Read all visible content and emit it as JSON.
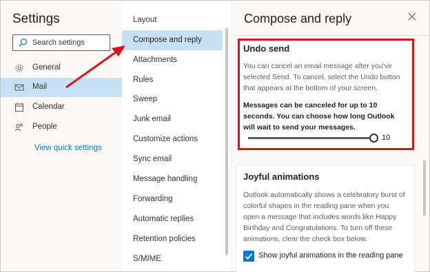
{
  "left": {
    "title": "Settings",
    "search_placeholder": "Search settings",
    "nav": [
      {
        "label": "General",
        "icon": "gear-icon",
        "selected": false
      },
      {
        "label": "Mail",
        "icon": "mail-icon",
        "selected": true
      },
      {
        "label": "Calendar",
        "icon": "calendar-icon",
        "selected": false
      },
      {
        "label": "People",
        "icon": "people-icon",
        "selected": false
      }
    ],
    "quick_settings": "View quick settings"
  },
  "middle": {
    "items": [
      {
        "label": "Layout"
      },
      {
        "label": "Compose and reply",
        "selected": true
      },
      {
        "label": "Attachments"
      },
      {
        "label": "Rules"
      },
      {
        "label": "Sweep"
      },
      {
        "label": "Junk email"
      },
      {
        "label": "Customize actions"
      },
      {
        "label": "Sync email"
      },
      {
        "label": "Message handling"
      },
      {
        "label": "Forwarding"
      },
      {
        "label": "Automatic replies"
      },
      {
        "label": "Retention policies"
      },
      {
        "label": "S/MIME"
      }
    ]
  },
  "right": {
    "title": "Compose and reply",
    "undo_send": {
      "title": "Undo send",
      "desc": "You can cancel an email message after you've selected Send. To cancel, select the Undo button that appears at the bottom of your screen.",
      "limit": "Messages can be canceled for up to 10 seconds. You can choose how long Outlook will wait to send your messages.",
      "slider_value": "10"
    },
    "joyful": {
      "title": "Joyful animations",
      "desc": "Outlook automatically shows a celebratory burst of colorful shapes in the reading pane when you open a message that includes words like Happy Birthday and Congratulations. To turn off these animations, clear the check box below.",
      "checkbox_label": "Show joyful animations in the reading pane",
      "checked": true
    }
  },
  "colors": {
    "accent": "#0078d4",
    "selected_bg": "#c7e0f4",
    "annotation": "#e0101a"
  }
}
